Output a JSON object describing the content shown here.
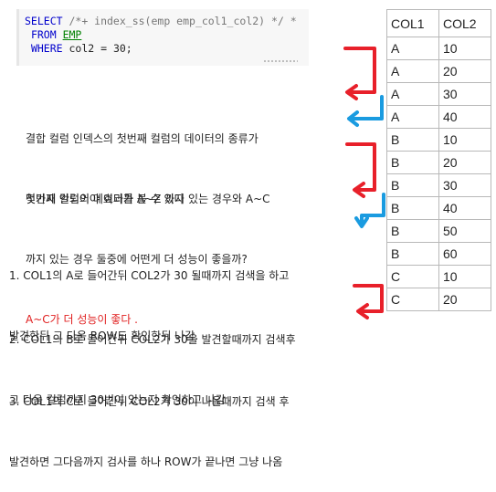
{
  "code": {
    "line1": [
      "SELECT",
      " /*+ index_ss(emp emp_col1_col2) */ *"
    ],
    "line2": [
      "FROM",
      " ",
      "EMP"
    ],
    "line3": [
      "WHERE",
      " col2 = 30;"
    ]
  },
  "intro": {
    "line1": "결합 컬럼 인덱스의 첫번째 컬럼의 데이터의 종류가",
    "line2": "몇가지 안되어야 효과를 볼 수 있다"
  },
  "question": {
    "line1": "첫번째 컬럼의 데이터가 A~Z 까지 있는 경우와 A~C",
    "line2": "까지 있는 경우 둘중에 어떤게 더 성능이 좋을까?",
    "answer": "A~C가 더 성능이 좋다 ."
  },
  "steps": [
    {
      "line1": "1. COL1의 A로 들어간뒤 COL2가 30 될때까지 검색을 하고",
      "line2": "발견한뒤 그 다음 ROW도 확인한뒤 나감."
    },
    {
      "line1": "2. COL1의 B로 들어간뒤 COL2가 30을 발견할때까지 검색후",
      "line2": "그 다음 컬럼까지 30번이 있는지 확인하고 나감"
    },
    {
      "line1": "3. COL1의 C로 들어간뒤 COL2가 30이 나올때까지 검색 후",
      "line2": "발견하면 그다음까지 검사를 하나 ROW가 끝나면 그냥 나옴"
    }
  ],
  "table": {
    "headers": [
      "COL1",
      "COL2"
    ],
    "rows": [
      [
        "A",
        "10"
      ],
      [
        "A",
        "20"
      ],
      [
        "A",
        "30"
      ],
      [
        "A",
        "40"
      ],
      [
        "B",
        "10"
      ],
      [
        "B",
        "20"
      ],
      [
        "B",
        "30"
      ],
      [
        "B",
        "40"
      ],
      [
        "B",
        "50"
      ],
      [
        "B",
        "60"
      ],
      [
        "C",
        "10"
      ],
      [
        "C",
        "20"
      ]
    ]
  },
  "colors": {
    "red_arrow": "#e8202a",
    "blue_arrow": "#1a9be0",
    "answer_text": "#e02020"
  }
}
